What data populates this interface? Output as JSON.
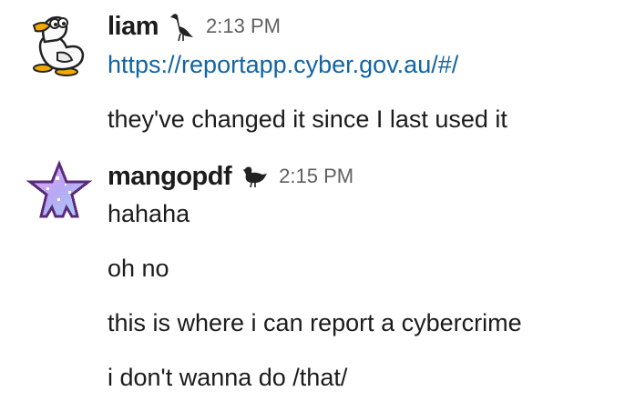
{
  "messages": [
    {
      "author": "liam",
      "avatar_icon": "duck-avatar-icon",
      "status_icon": "heron-bird-icon",
      "time": "2:13 PM",
      "lines": [
        "https://reportapp.cyber.gov.au/#/",
        "they've changed it since I last used it"
      ]
    },
    {
      "author": "mangopdf",
      "avatar_icon": "pixel-star-avatar-icon",
      "status_icon": "duck-bird-icon",
      "time": "2:15 PM",
      "lines": [
        "hahaha",
        "oh no",
        "this is where i can report a cybercrime",
        "i don't wanna do /that/"
      ]
    }
  ],
  "colors": {
    "text": "#1d1c1d",
    "timestamp": "#616061",
    "link": "#1264a3"
  }
}
